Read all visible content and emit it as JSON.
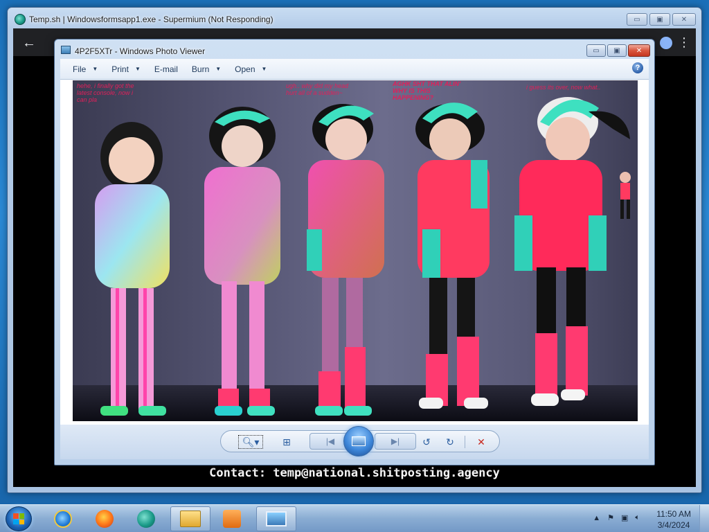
{
  "outer_window": {
    "title": "Temp.sh | Windowsformsapp1.exe - Supermium (Not Responding)",
    "caption_minimize": "▭",
    "caption_maximize": "▣",
    "caption_close": "✕",
    "back_label": "←",
    "menu_label": "⋮",
    "contact_text": "Contact: temp@national.shitposting.agency"
  },
  "photo_viewer": {
    "title": "4P2F5XTr - Windows Photo Viewer",
    "menus": [
      {
        "label": "File",
        "has_caret": true
      },
      {
        "label": "Print",
        "has_caret": true
      },
      {
        "label": "E-mail",
        "has_caret": false
      },
      {
        "label": "Burn",
        "has_caret": true
      },
      {
        "label": "Open",
        "has_caret": true
      }
    ],
    "help_label": "?",
    "image_captions": {
      "panel1": "hehe, i finally got the\nlatest console, now i\ncan pla",
      "panel3": "ugh.. why did my head\nhurt all of a sudden~",
      "panel4": "AGHK SHT THAT ALIN'\nWHY IS THIS\nHAPPENING?",
      "panel5": "i guess its over, now what.."
    },
    "controls": {
      "zoom_icon": "zoom-icon",
      "fit_icon": "fit-icon",
      "prev_icon": "previous-icon",
      "slideshow_icon": "slideshow-icon",
      "next_icon": "next-icon",
      "rotate_ccw_icon": "rotate-counterclockwise-icon",
      "rotate_cw_icon": "rotate-clockwise-icon",
      "delete_icon": "delete-icon"
    }
  },
  "taskbar": {
    "clock_time": "11:50 AM",
    "clock_date": "3/4/2024",
    "tray_chevron": "▲",
    "pinned": [
      "internet-explorer-icon",
      "firefox-icon",
      "supermium-icon",
      "file-explorer-icon",
      "media-player-icon",
      "photo-viewer-icon"
    ]
  }
}
